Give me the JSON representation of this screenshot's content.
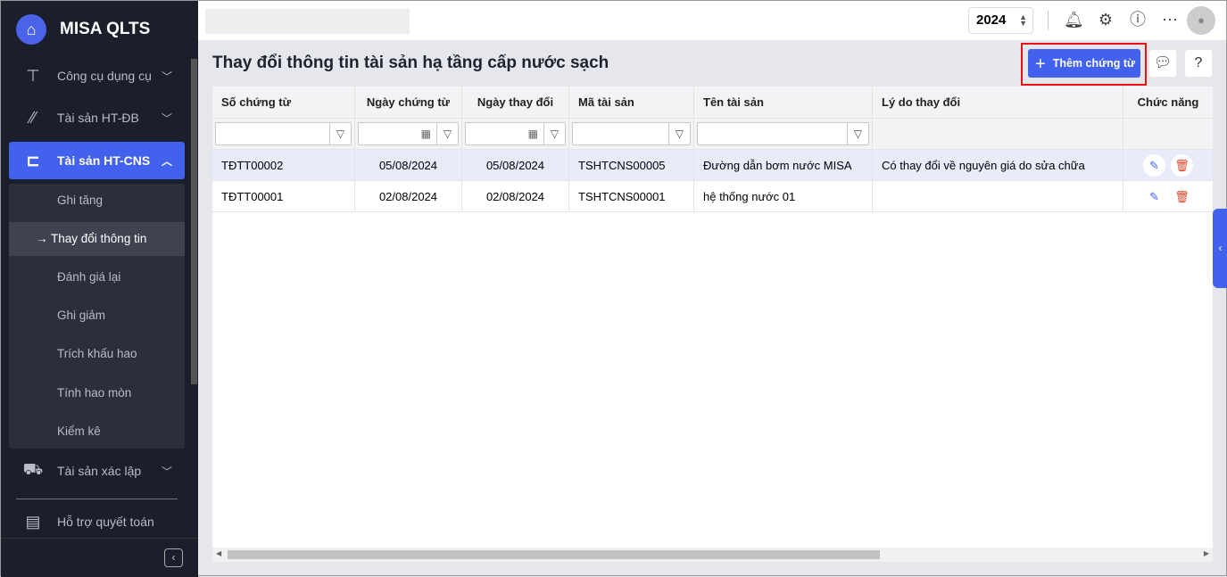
{
  "app": {
    "name": "MISA QLTS"
  },
  "sidebar": {
    "items": [
      {
        "label": "Công cụ dụng cụ",
        "icon": "paint-roller-icon"
      },
      {
        "label": "Tài sản HT-ĐB",
        "icon": "road-icon"
      },
      {
        "label": "Tài sản HT-CNS",
        "icon": "water-pipe-icon"
      },
      {
        "label": "Tài sản xác lập",
        "icon": "car-house-icon"
      },
      {
        "label": "Hỗ trợ quyết toán",
        "icon": "clipboard-icon"
      }
    ],
    "sub": [
      "Ghi tăng",
      "Thay đổi thông tin",
      "Đánh giá lại",
      "Ghi giảm",
      "Trích khấu hao",
      "Tính hao mòn",
      "Kiểm kê"
    ]
  },
  "topbar": {
    "year": "2024"
  },
  "page": {
    "title": "Thay đổi thông tin tài sản hạ tầng cấp nước sạch",
    "add_label": "Thêm chứng từ"
  },
  "table": {
    "headers": [
      "Số chứng từ",
      "Ngày chứng từ",
      "Ngày thay đổi",
      "Mã tài sản",
      "Tên tài sản",
      "Lý do thay đổi",
      "Chức năng"
    ],
    "rows": [
      [
        "TĐTT00002",
        "05/08/2024",
        "05/08/2024",
        "TSHTCNS00005",
        "Đường dẫn bơm nước MISA",
        "Có thay đổi về nguyên giá do sửa chữa"
      ],
      [
        "TĐTT00001",
        "02/08/2024",
        "02/08/2024",
        "TSHTCNS00001",
        "hệ thống nước 01",
        ""
      ]
    ]
  },
  "colors": {
    "accent": "#4262ee",
    "sidebar": "#1b1e2b",
    "delete": "#e0452b"
  }
}
